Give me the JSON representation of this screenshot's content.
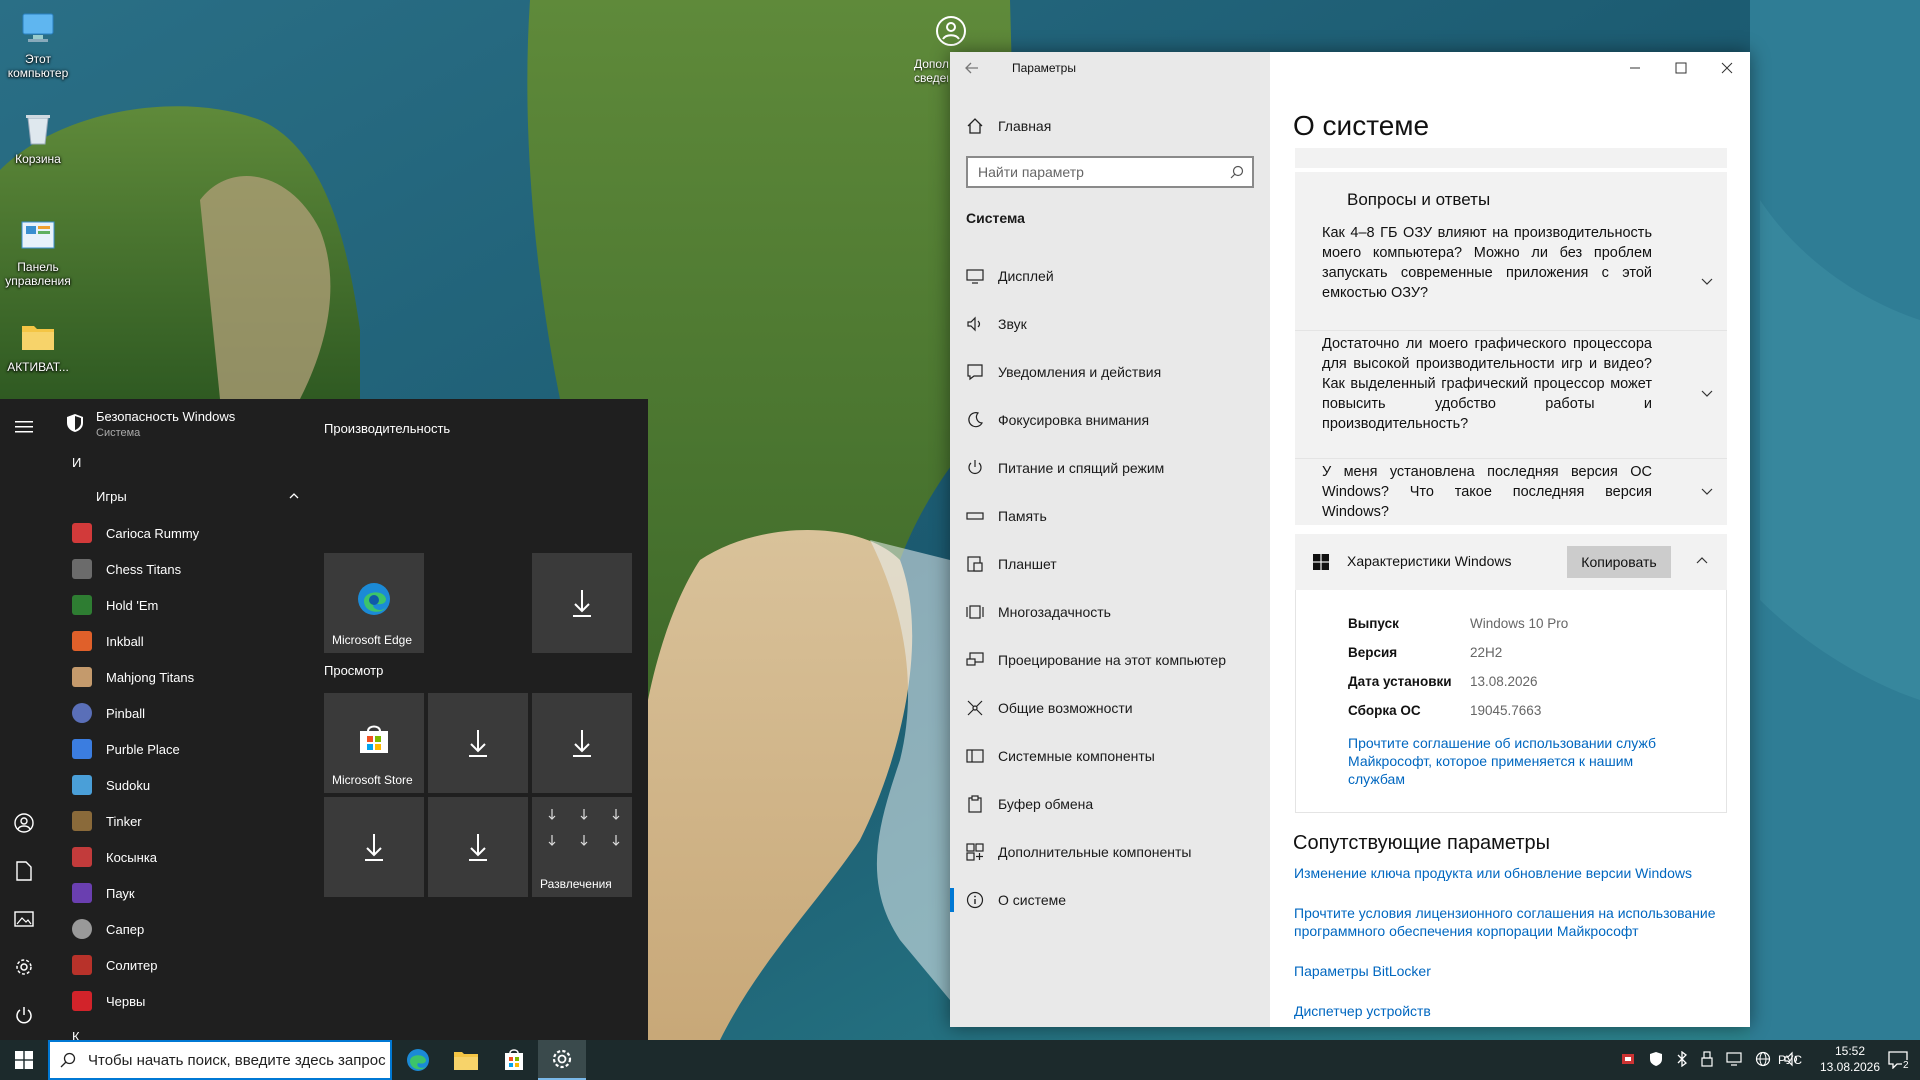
{
  "desktop": {
    "icons": [
      {
        "label": "Этот компьютер",
        "icon": "this-pc-icon"
      },
      {
        "label": "Корзина",
        "icon": "recycle-bin-icon"
      },
      {
        "label": "Панель управления",
        "icon": "control-panel-icon"
      },
      {
        "label": "АКТИВАТ...",
        "icon": "folder-icon"
      }
    ],
    "extra_icon_label": "Дополнительные сведения"
  },
  "start_menu": {
    "pinned_header": {
      "title": "Безопасность Windows",
      "subtitle": "Система"
    },
    "letter_i": "И",
    "folder_label": "Игры",
    "apps": [
      {
        "label": "Carioca Rummy",
        "color": "#d23a3a"
      },
      {
        "label": "Chess Titans",
        "color": "#6b6b6b"
      },
      {
        "label": "Hold 'Em",
        "color": "#2e7d32"
      },
      {
        "label": "Inkball",
        "color": "#e0602a"
      },
      {
        "label": "Mahjong Titans",
        "color": "#c49a6c"
      },
      {
        "label": "Pinball",
        "color": "#5a6fb8"
      },
      {
        "label": "Purble Place",
        "color": "#3b7de0"
      },
      {
        "label": "Sudoku",
        "color": "#4a9fd8"
      },
      {
        "label": "Tinker",
        "color": "#8a6a3a"
      },
      {
        "label": "Косынка",
        "color": "#c23b3b"
      },
      {
        "label": "Паук",
        "color": "#6a3fb0"
      },
      {
        "label": "Сапер",
        "color": "#999999"
      },
      {
        "label": "Солитер",
        "color": "#b8322a"
      },
      {
        "label": "Червы",
        "color": "#d2232a"
      }
    ],
    "letter_k": "К",
    "groups": [
      {
        "title": "Производительность"
      },
      {
        "title": "Просмотр"
      }
    ],
    "tiles": {
      "edge": "Microsoft Edge",
      "store": "Microsoft Store",
      "entertainment": "Развлечения"
    }
  },
  "settings": {
    "window_title": "Параметры",
    "home_label": "Главная",
    "search_placeholder": "Найти параметр",
    "section_label": "Система",
    "nav_items": [
      {
        "label": "Дисплей",
        "icon": "display-icon"
      },
      {
        "label": "Звук",
        "icon": "sound-icon"
      },
      {
        "label": "Уведомления и действия",
        "icon": "notifications-icon"
      },
      {
        "label": "Фокусировка внимания",
        "icon": "focus-assist-icon"
      },
      {
        "label": "Питание и спящий режим",
        "icon": "power-icon"
      },
      {
        "label": "Память",
        "icon": "storage-icon"
      },
      {
        "label": "Планшет",
        "icon": "tablet-icon"
      },
      {
        "label": "Многозадачность",
        "icon": "multitasking-icon"
      },
      {
        "label": "Проецирование на этот компьютер",
        "icon": "projecting-icon"
      },
      {
        "label": "Общие возможности",
        "icon": "shared-experiences-icon"
      },
      {
        "label": "Системные компоненты",
        "icon": "system-components-icon"
      },
      {
        "label": "Буфер обмена",
        "icon": "clipboard-icon"
      },
      {
        "label": "Дополнительные компоненты",
        "icon": "optional-features-icon"
      },
      {
        "label": "О системе",
        "icon": "about-icon"
      }
    ],
    "page_title": "О системе",
    "faq_title": "Вопросы и ответы",
    "faq": [
      "Как 4–8 ГБ ОЗУ влияют на производительность моего компьютера? Можно ли без проблем запускать современные приложения с этой емкостью ОЗУ?",
      "Достаточно ли моего графического процессора для высокой производительности игр и видео? Как выделенный графический процессор может повысить удобство работы и производительность?",
      "У меня установлена последняя версия ОС Windows? Что такое последняя версия Windows?"
    ],
    "spec_title": "Характеристики Windows",
    "copy_button": "Копировать",
    "specs": [
      {
        "key": "Выпуск",
        "value": "Windows 10 Pro"
      },
      {
        "key": "Версия",
        "value": "22H2"
      },
      {
        "key": "Дата установки",
        "value": "13.08.2026"
      },
      {
        "key": "Сборка ОС",
        "value": "19045.7663"
      }
    ],
    "agreement_link": "Прочтите соглашение об использовании служб Майкрософт, которое применяется к нашим службам",
    "related_title": "Сопутствующие параметры",
    "related_links": [
      "Изменение ключа продукта или обновление версии Windows",
      "Прочтите условия лицензионного соглашения на использование программного обеспечения корпорации Майкрософт",
      "Параметры BitLocker",
      "Диспетчер устройств"
    ]
  },
  "taskbar": {
    "search_placeholder": "Чтобы начать поиск, введите здесь запрос",
    "language": "РУС",
    "time": "15:52",
    "date": "13.08.2026",
    "notification_count": "2",
    "accent": "#0078d4"
  }
}
